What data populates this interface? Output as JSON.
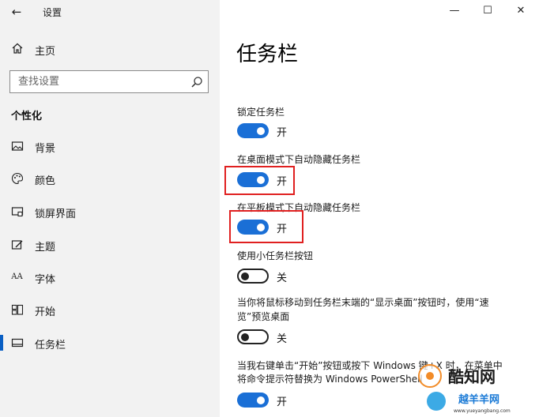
{
  "window": {
    "title": "设置",
    "controls": {
      "minimize": "—",
      "maximize": "☐",
      "close": "✕"
    }
  },
  "sidebar": {
    "back_glyph": "←",
    "home": {
      "label": "主页",
      "icon": "home-icon"
    },
    "search": {
      "placeholder": "查找设置",
      "icon": "search-icon"
    },
    "section_title": "个性化",
    "items": [
      {
        "label": "背景",
        "icon": "picture-icon",
        "active": false
      },
      {
        "label": "颜色",
        "icon": "palette-icon",
        "active": false
      },
      {
        "label": "锁屏界面",
        "icon": "lock-screen-icon",
        "active": false
      },
      {
        "label": "主题",
        "icon": "theme-brush-icon",
        "active": false
      },
      {
        "label": "字体",
        "icon": "font-icon",
        "active": false
      },
      {
        "label": "开始",
        "icon": "start-grid-icon",
        "active": false
      },
      {
        "label": "任务栏",
        "icon": "taskbar-icon",
        "active": true
      }
    ],
    "font_icon_text": "AA"
  },
  "main": {
    "title": "任务栏",
    "settings": [
      {
        "label": "锁定任务栏",
        "state": "开",
        "on": true
      },
      {
        "label": "在桌面模式下自动隐藏任务栏",
        "state": "开",
        "on": true,
        "highlighted": true
      },
      {
        "label": "在平板模式下自动隐藏任务栏",
        "state": "开",
        "on": true,
        "highlighted": true
      },
      {
        "label": "使用小任务栏按钮",
        "state": "关",
        "on": false
      },
      {
        "label_line1": "当你将鼠标移动到任务栏末端的“显示桌面”按钮时，使用“速",
        "label_line2": "览”预览桌面",
        "state": "关",
        "on": false
      },
      {
        "label_line1": "当我右键单击“开始”按钮或按下 Windows 键+X 时，在菜单中",
        "label_line2": "将命令提示符替换为 Windows PowerShell",
        "state": "开",
        "on": true
      }
    ]
  },
  "watermark": {
    "brand": "酷知网",
    "sub": "越羊羊网",
    "url": "www.yueyangbang.com"
  },
  "colors": {
    "accent": "#1a6fd6",
    "highlight": "#e02020",
    "sidebar_bg": "#f2f2f2",
    "active_bar": "#0a5fc4"
  }
}
